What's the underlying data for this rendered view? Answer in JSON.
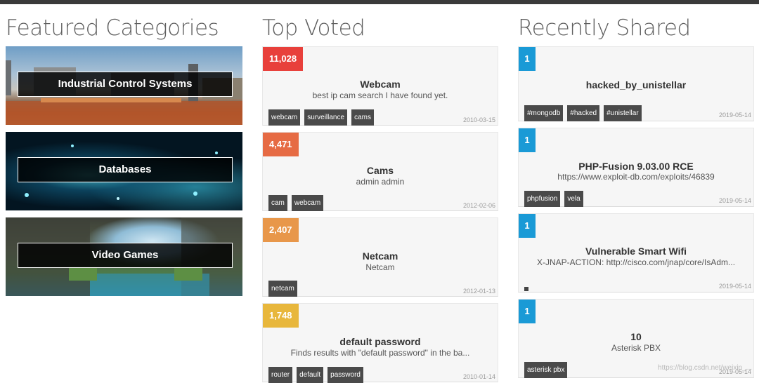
{
  "headings": {
    "featured": "Featured Categories",
    "top_voted": "Top Voted",
    "recently_shared": "Recently Shared"
  },
  "featured": [
    {
      "label": "Industrial Control Systems"
    },
    {
      "label": "Databases"
    },
    {
      "label": "Video Games"
    }
  ],
  "top_voted": [
    {
      "votes": "11,028",
      "color": "#e8403b",
      "title": "Webcam",
      "desc": "best ip cam search I have found yet.",
      "tags": [
        "webcam",
        "surveillance",
        "cams"
      ],
      "date": "2010-03-15"
    },
    {
      "votes": "4,471",
      "color": "#e66b44",
      "title": "Cams",
      "desc": "admin admin",
      "tags": [
        "cam",
        "webcam"
      ],
      "date": "2012-02-06"
    },
    {
      "votes": "2,407",
      "color": "#e8974a",
      "title": "Netcam",
      "desc": "Netcam",
      "tags": [
        "netcam"
      ],
      "date": "2012-01-13"
    },
    {
      "votes": "1,748",
      "color": "#e8b73c",
      "title": "default password",
      "desc": "Finds results with \"default password\" in the ba...",
      "tags": [
        "router",
        "default",
        "password"
      ],
      "date": "2010-01-14"
    }
  ],
  "recently_shared": [
    {
      "count": "1",
      "title": "hacked_by_unistellar",
      "desc": "",
      "tags": [
        "#mongodb",
        "#hacked",
        "#unistellar"
      ],
      "date": "2019-05-14"
    },
    {
      "count": "1",
      "title": "PHP-Fusion 9.03.00 RCE",
      "desc": "https://www.exploit-db.com/exploits/46839",
      "tags": [
        "phpfusion",
        "vela"
      ],
      "date": "2019-05-14"
    },
    {
      "count": "1",
      "title": "Vulnerable Smart Wifi",
      "desc": "X-JNAP-ACTION: http://cisco.com/jnap/core/IsAdm...",
      "tags": [],
      "date": "2019-05-14"
    },
    {
      "count": "1",
      "title": "10",
      "desc": "Asterisk PBX",
      "tags": [
        "asterisk pbx"
      ],
      "date": "2019-05-14"
    }
  ],
  "watermark": "https://blog.csdn.net/weixin_..."
}
